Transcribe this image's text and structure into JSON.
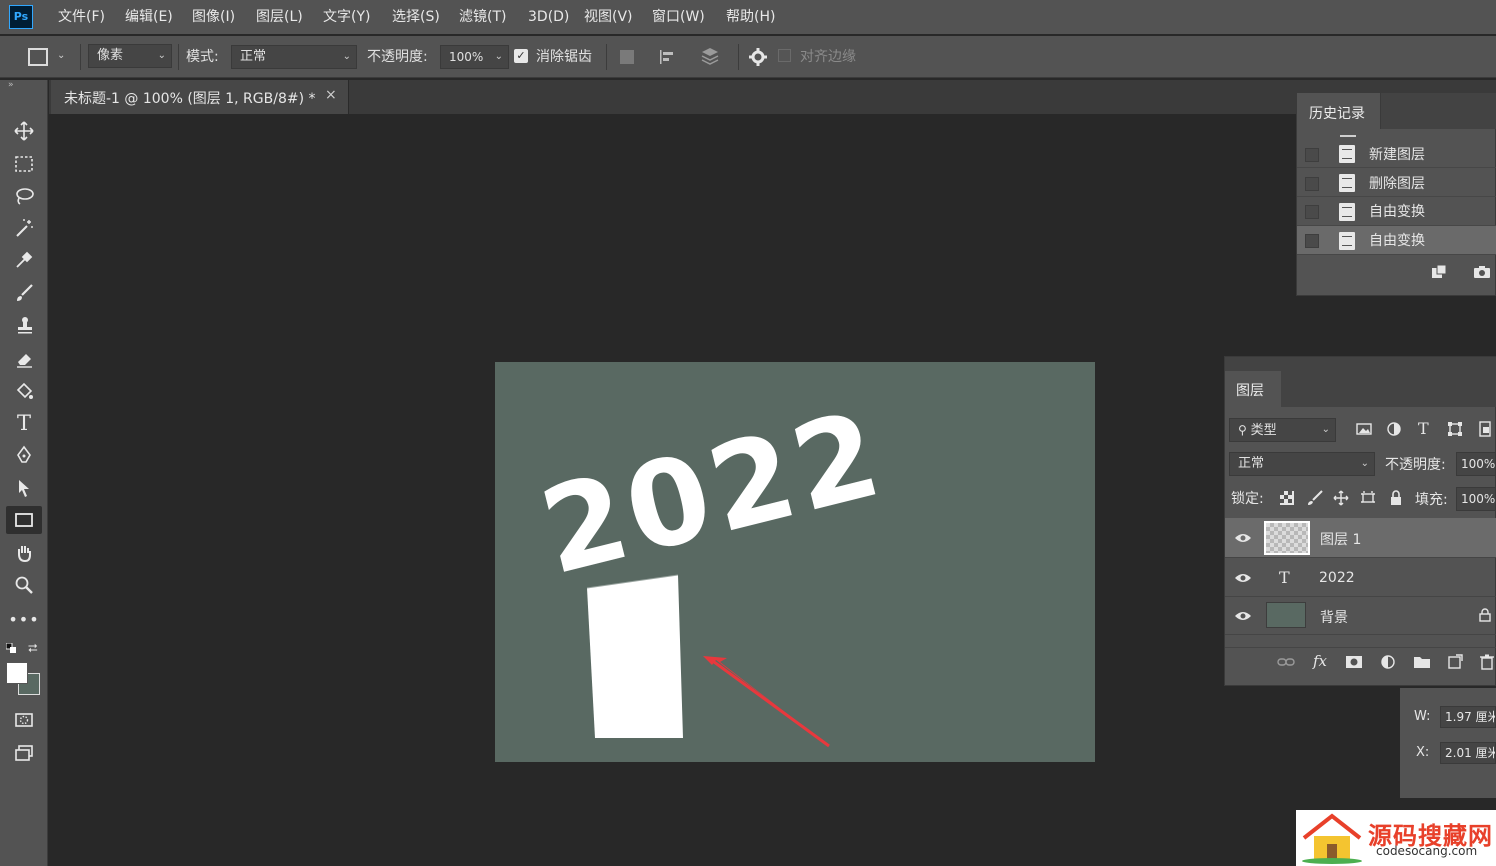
{
  "app": {
    "logo": "Ps"
  },
  "menu": [
    "文件(F)",
    "编辑(E)",
    "图像(I)",
    "图层(L)",
    "文字(Y)",
    "选择(S)",
    "滤镜(T)",
    "3D(D)",
    "视图(V)",
    "窗口(W)",
    "帮助(H)"
  ],
  "options": {
    "feather_unit": "像素",
    "mode_label": "模式:",
    "mode_value": "正常",
    "opacity_label": "不透明度:",
    "opacity_value": "100%",
    "antialias_label": "消除锯齿",
    "align_edges_label": "对齐边缘"
  },
  "document": {
    "tab_title": "未标题-1 @ 100% (图层 1, RGB/8#) *",
    "tab_close": "×",
    "canvas_text": "2022",
    "canvas_color": "#596962"
  },
  "history": {
    "title": "历史记录",
    "items": [
      {
        "label": "新建图层",
        "active": false
      },
      {
        "label": "删除图层",
        "active": false
      },
      {
        "label": "自由变换",
        "active": false
      },
      {
        "label": "自由变换",
        "active": true
      }
    ]
  },
  "layers": {
    "title": "图层",
    "filter_label": "类型",
    "blend_mode": "正常",
    "opacity_label": "不透明度:",
    "opacity_value": "100%",
    "lock_label": "锁定:",
    "fill_label": "填充:",
    "fill_value": "100%",
    "items": [
      {
        "name": "图层 1",
        "type": "pixel",
        "selected": true
      },
      {
        "name": "2022",
        "type": "text",
        "selected": false
      },
      {
        "name": "背景",
        "type": "background",
        "selected": false,
        "locked": true
      }
    ],
    "footer_fx": "fx"
  },
  "properties": {
    "w_label": "W:",
    "w_value": "1.97 厘米",
    "x_label": "X:",
    "x_value": "2.01 厘米"
  },
  "watermark": {
    "title": "源码搜藏网",
    "url": "codesocang.com"
  }
}
